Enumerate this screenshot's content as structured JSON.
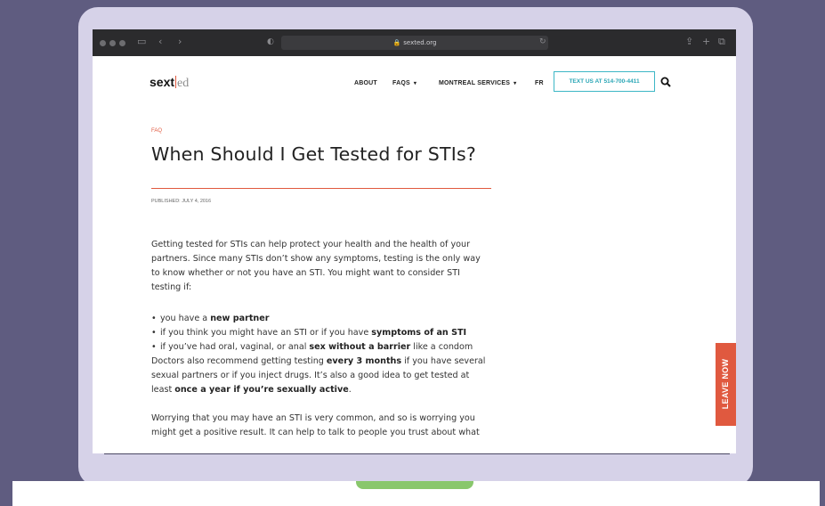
{
  "browser": {
    "url": "sexted.org"
  },
  "site": {
    "logo_main": "sext",
    "logo_sub": "ed",
    "nav": [
      {
        "label": "ABOUT"
      },
      {
        "label": "FAQS",
        "caret": "▾"
      },
      {
        "label": "MONTREAL SERVICES",
        "caret": "▾"
      },
      {
        "label": "FR"
      }
    ],
    "cta_label": "TEXT US AT 514-700-4411"
  },
  "article": {
    "category": "FAQ",
    "title": "When Should I Get Tested for STIs?",
    "published": "PUBLISHED: JULY 4, 2016",
    "intro_lines": [
      "Getting tested for STIs can help protect your health and the health of your",
      "partners. Since many STIs don’t show any symptoms, testing is the only way",
      "to know whether or not you have an STI. You might want to consider STI",
      "testing if:"
    ],
    "bullets": [
      {
        "pre": "you have a ",
        "bold": "new partner",
        "post": ""
      },
      {
        "pre": "if you think you might have an STI or if you have ",
        "bold": "symptoms of an STI",
        "post": ""
      },
      {
        "pre": "if you’ve had oral, vaginal, or anal ",
        "bold": "sex without a barrier",
        "post": " like a condom"
      }
    ],
    "para2": {
      "l1_pre": "Doctors also recommend getting testing ",
      "l1_bold": "every 3 months",
      "l1_post": " if you have several",
      "l2": "sexual partners or if you inject drugs. It’s also a good idea to get tested at",
      "l3_pre": "least ",
      "l3_bold": "once a year if you’re sexually active",
      "l3_post": "."
    },
    "para3_lines": [
      "Worrying that you may have an STI is very common, and so is worrying you",
      "might get a positive result. It can help to talk to people you trust about what"
    ]
  },
  "leave_now_label": "LEAVE NOW",
  "colors": {
    "accent": "#e0593f",
    "teal": "#3db7c6",
    "background": "#5f5c80",
    "laptop": "#d6d2e8"
  }
}
